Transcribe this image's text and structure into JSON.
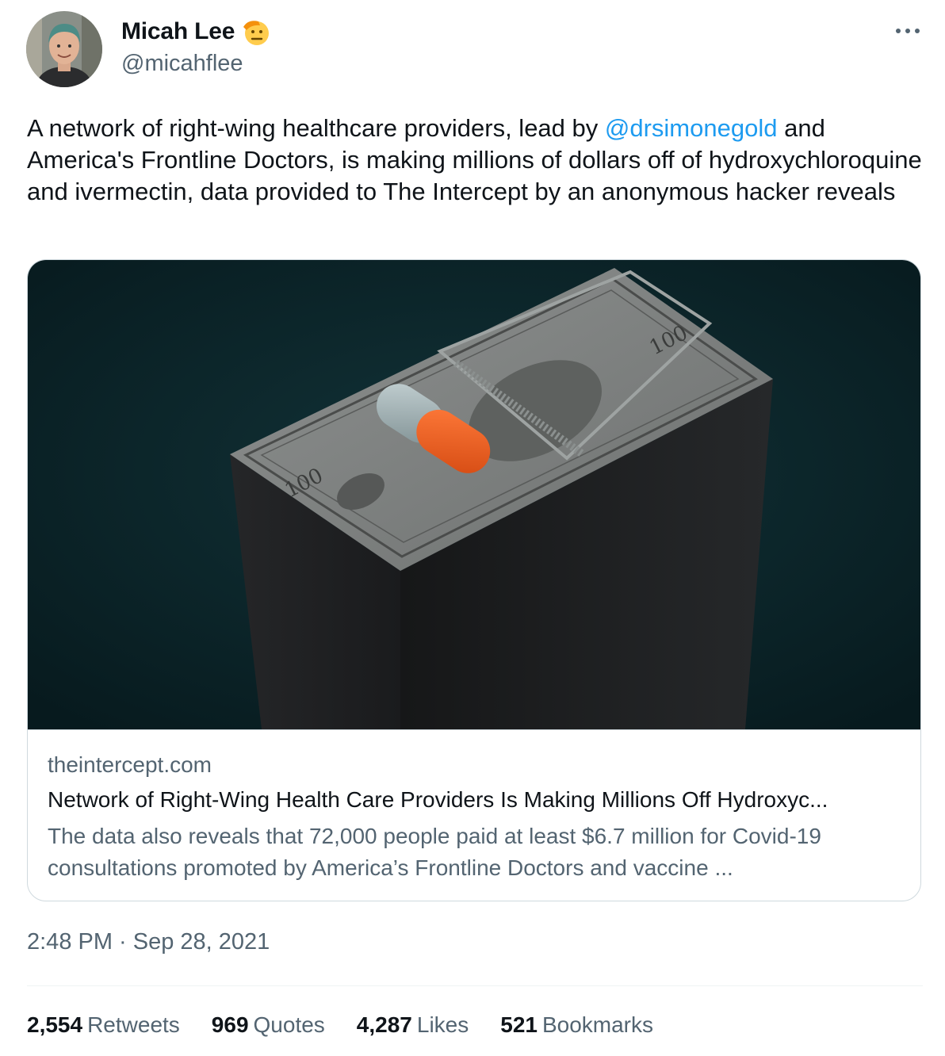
{
  "author": {
    "display_name": "Micah Lee",
    "handle": "@micahflee",
    "badge_icon": "saluting-face-emoji"
  },
  "more_icon": "more-horizontal-icon",
  "tweet": {
    "text_part1": "A network of right-wing healthcare providers, lead by ",
    "mention": "@drsimonegold",
    "text_part2": " and America's Frontline Doctors, is making millions of dollars off of hydroxychloroquine and ivermectin, data provided to The Intercept by an anonymous hacker reveals"
  },
  "card": {
    "image_subject": "stack of 100 dollar bills with a mousetrap and an orange pill",
    "domain": "theintercept.com",
    "title": "Network of Right-Wing Health Care Providers Is Making Millions Off Hydroxyc...",
    "description": "The data also reveals that 72,000 people paid at least $6.7 million for Covid-19 consultations promoted by America’s Frontline Doctors and vaccine ..."
  },
  "timestamp": "2:48 PM · Sep 28, 2021",
  "stats": [
    {
      "count": "2,554",
      "label": "Retweets"
    },
    {
      "count": "969",
      "label": "Quotes"
    },
    {
      "count": "4,287",
      "label": "Likes"
    },
    {
      "count": "521",
      "label": "Bookmarks"
    }
  ],
  "colors": {
    "link": "#1d9bf0",
    "secondary_text": "#536471",
    "primary_text": "#0f1419",
    "border": "#cfd9de"
  }
}
